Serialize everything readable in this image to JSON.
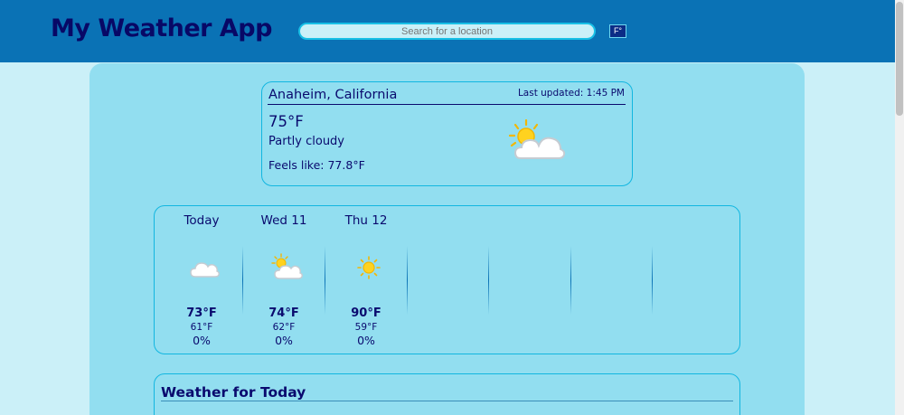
{
  "header": {
    "title": "My Weather App",
    "search_placeholder": "Search for a location",
    "unit_toggle": "F°"
  },
  "current": {
    "location": "Anaheim, California",
    "updated_label": "Last updated: 1:45 PM",
    "temperature": "75°F",
    "condition": "Partly cloudy",
    "feels_like_label": "Feels like:",
    "feels_like_value": "77.8°F",
    "icon": "partly-cloudy-icon"
  },
  "forecast": [
    {
      "day": "Today",
      "icon": "cloud-icon",
      "high": "73°F",
      "low": "61°F",
      "precip": "0%"
    },
    {
      "day": "Wed 11",
      "icon": "partly-cloudy-icon",
      "high": "74°F",
      "low": "62°F",
      "precip": "0%"
    },
    {
      "day": "Thu 12",
      "icon": "sun-icon",
      "high": "90°F",
      "low": "59°F",
      "precip": "0%"
    }
  ],
  "today_panel": {
    "title": "Weather for Today"
  },
  "colors": {
    "header_bg": "#0a72b5",
    "page_bg": "#cbf0f8",
    "panel_bg": "#92def0",
    "text": "#0a0a6e",
    "accent_border": "#12b6e0"
  }
}
